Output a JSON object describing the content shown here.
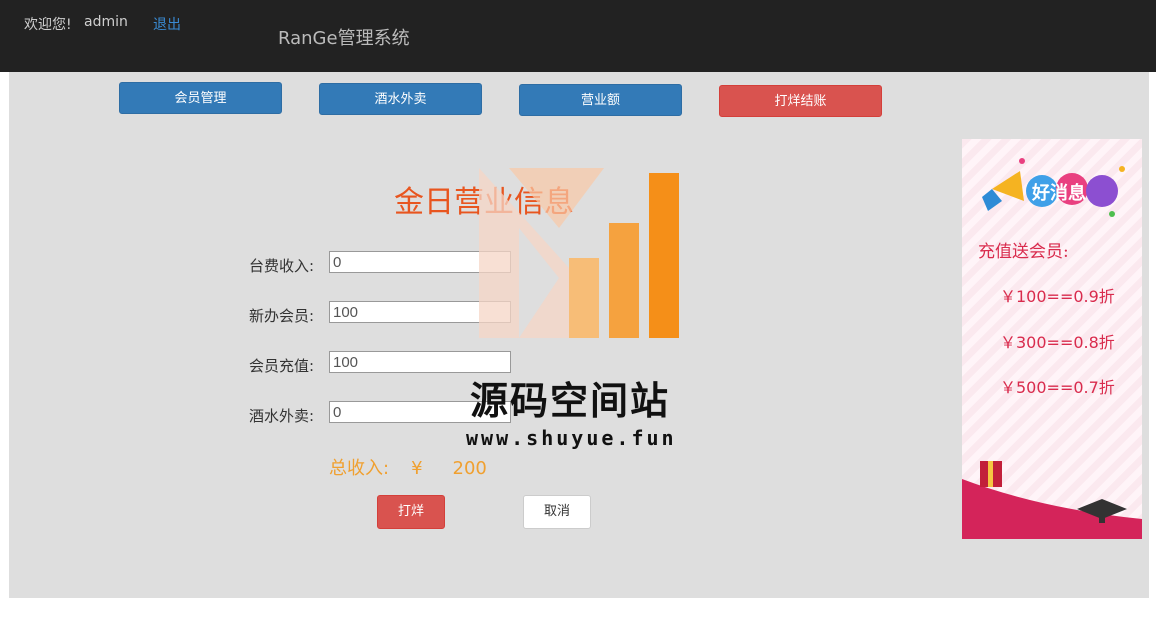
{
  "header": {
    "welcome": "欢迎您!",
    "username": "admin",
    "logout": "退出",
    "brand": "RanGe管理系统"
  },
  "nav": {
    "members": "会员管理",
    "drinks": "酒水外卖",
    "revenue": "营业额",
    "print_checkout": "打烊结账"
  },
  "form": {
    "title": "金日营业信息",
    "table_fee_label": "台费收入:",
    "table_fee_value": "0",
    "new_member_label": "新办会员:",
    "new_member_value": "100",
    "recharge_label": "会员充值:",
    "recharge_value": "100",
    "drinks_label": "酒水外卖:",
    "drinks_value": "0",
    "total_label": "总收入:",
    "total_currency": "¥",
    "total_amount": "200",
    "print_button": "打烊",
    "cancel_button": "取消"
  },
  "promo": {
    "badge": "好消息",
    "title": "充值送会员:",
    "items": [
      "￥100==0.9折",
      "￥300==0.8折",
      "￥500==0.7折"
    ]
  },
  "watermark": {
    "text": "源码空间站",
    "url": "www.shuyue.fun"
  },
  "colors": {
    "topbar": "#222222",
    "primary": "#337ab7",
    "danger": "#d9534f",
    "title": "#e8551f",
    "total": "#f0a030",
    "promo": "#d92b4d"
  }
}
